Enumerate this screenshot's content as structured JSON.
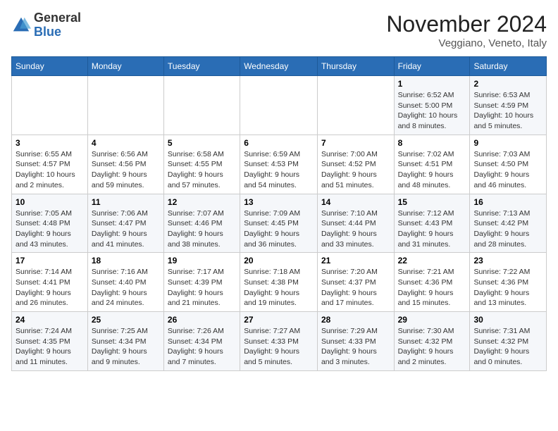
{
  "logo": {
    "general": "General",
    "blue": "Blue"
  },
  "title": "November 2024",
  "location": "Veggiano, Veneto, Italy",
  "days_of_week": [
    "Sunday",
    "Monday",
    "Tuesday",
    "Wednesday",
    "Thursday",
    "Friday",
    "Saturday"
  ],
  "weeks": [
    [
      {
        "day": "",
        "info": ""
      },
      {
        "day": "",
        "info": ""
      },
      {
        "day": "",
        "info": ""
      },
      {
        "day": "",
        "info": ""
      },
      {
        "day": "",
        "info": ""
      },
      {
        "day": "1",
        "info": "Sunrise: 6:52 AM\nSunset: 5:00 PM\nDaylight: 10 hours and 8 minutes."
      },
      {
        "day": "2",
        "info": "Sunrise: 6:53 AM\nSunset: 4:59 PM\nDaylight: 10 hours and 5 minutes."
      }
    ],
    [
      {
        "day": "3",
        "info": "Sunrise: 6:55 AM\nSunset: 4:57 PM\nDaylight: 10 hours and 2 minutes."
      },
      {
        "day": "4",
        "info": "Sunrise: 6:56 AM\nSunset: 4:56 PM\nDaylight: 9 hours and 59 minutes."
      },
      {
        "day": "5",
        "info": "Sunrise: 6:58 AM\nSunset: 4:55 PM\nDaylight: 9 hours and 57 minutes."
      },
      {
        "day": "6",
        "info": "Sunrise: 6:59 AM\nSunset: 4:53 PM\nDaylight: 9 hours and 54 minutes."
      },
      {
        "day": "7",
        "info": "Sunrise: 7:00 AM\nSunset: 4:52 PM\nDaylight: 9 hours and 51 minutes."
      },
      {
        "day": "8",
        "info": "Sunrise: 7:02 AM\nSunset: 4:51 PM\nDaylight: 9 hours and 48 minutes."
      },
      {
        "day": "9",
        "info": "Sunrise: 7:03 AM\nSunset: 4:50 PM\nDaylight: 9 hours and 46 minutes."
      }
    ],
    [
      {
        "day": "10",
        "info": "Sunrise: 7:05 AM\nSunset: 4:48 PM\nDaylight: 9 hours and 43 minutes."
      },
      {
        "day": "11",
        "info": "Sunrise: 7:06 AM\nSunset: 4:47 PM\nDaylight: 9 hours and 41 minutes."
      },
      {
        "day": "12",
        "info": "Sunrise: 7:07 AM\nSunset: 4:46 PM\nDaylight: 9 hours and 38 minutes."
      },
      {
        "day": "13",
        "info": "Sunrise: 7:09 AM\nSunset: 4:45 PM\nDaylight: 9 hours and 36 minutes."
      },
      {
        "day": "14",
        "info": "Sunrise: 7:10 AM\nSunset: 4:44 PM\nDaylight: 9 hours and 33 minutes."
      },
      {
        "day": "15",
        "info": "Sunrise: 7:12 AM\nSunset: 4:43 PM\nDaylight: 9 hours and 31 minutes."
      },
      {
        "day": "16",
        "info": "Sunrise: 7:13 AM\nSunset: 4:42 PM\nDaylight: 9 hours and 28 minutes."
      }
    ],
    [
      {
        "day": "17",
        "info": "Sunrise: 7:14 AM\nSunset: 4:41 PM\nDaylight: 9 hours and 26 minutes."
      },
      {
        "day": "18",
        "info": "Sunrise: 7:16 AM\nSunset: 4:40 PM\nDaylight: 9 hours and 24 minutes."
      },
      {
        "day": "19",
        "info": "Sunrise: 7:17 AM\nSunset: 4:39 PM\nDaylight: 9 hours and 21 minutes."
      },
      {
        "day": "20",
        "info": "Sunrise: 7:18 AM\nSunset: 4:38 PM\nDaylight: 9 hours and 19 minutes."
      },
      {
        "day": "21",
        "info": "Sunrise: 7:20 AM\nSunset: 4:37 PM\nDaylight: 9 hours and 17 minutes."
      },
      {
        "day": "22",
        "info": "Sunrise: 7:21 AM\nSunset: 4:36 PM\nDaylight: 9 hours and 15 minutes."
      },
      {
        "day": "23",
        "info": "Sunrise: 7:22 AM\nSunset: 4:36 PM\nDaylight: 9 hours and 13 minutes."
      }
    ],
    [
      {
        "day": "24",
        "info": "Sunrise: 7:24 AM\nSunset: 4:35 PM\nDaylight: 9 hours and 11 minutes."
      },
      {
        "day": "25",
        "info": "Sunrise: 7:25 AM\nSunset: 4:34 PM\nDaylight: 9 hours and 9 minutes."
      },
      {
        "day": "26",
        "info": "Sunrise: 7:26 AM\nSunset: 4:34 PM\nDaylight: 9 hours and 7 minutes."
      },
      {
        "day": "27",
        "info": "Sunrise: 7:27 AM\nSunset: 4:33 PM\nDaylight: 9 hours and 5 minutes."
      },
      {
        "day": "28",
        "info": "Sunrise: 7:29 AM\nSunset: 4:33 PM\nDaylight: 9 hours and 3 minutes."
      },
      {
        "day": "29",
        "info": "Sunrise: 7:30 AM\nSunset: 4:32 PM\nDaylight: 9 hours and 2 minutes."
      },
      {
        "day": "30",
        "info": "Sunrise: 7:31 AM\nSunset: 4:32 PM\nDaylight: 9 hours and 0 minutes."
      }
    ]
  ]
}
